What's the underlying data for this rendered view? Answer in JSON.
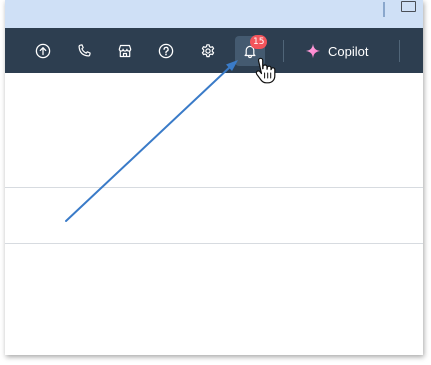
{
  "toolbar": {
    "icons": {
      "upgrade": "arrow-up-circle-icon",
      "calling": "phone-icon",
      "marketplace": "storefront-icon",
      "help": "question-circle-icon",
      "settings": "gear-icon",
      "notifications": "bell-icon"
    },
    "notification_count": "15",
    "copilot_label": "Copilot"
  },
  "colors": {
    "navbar": "#2d3e50",
    "badge": "#f2545b",
    "copilot_sparkle": "#ff8fd0",
    "annotation_arrow": "#3a7bc8"
  }
}
